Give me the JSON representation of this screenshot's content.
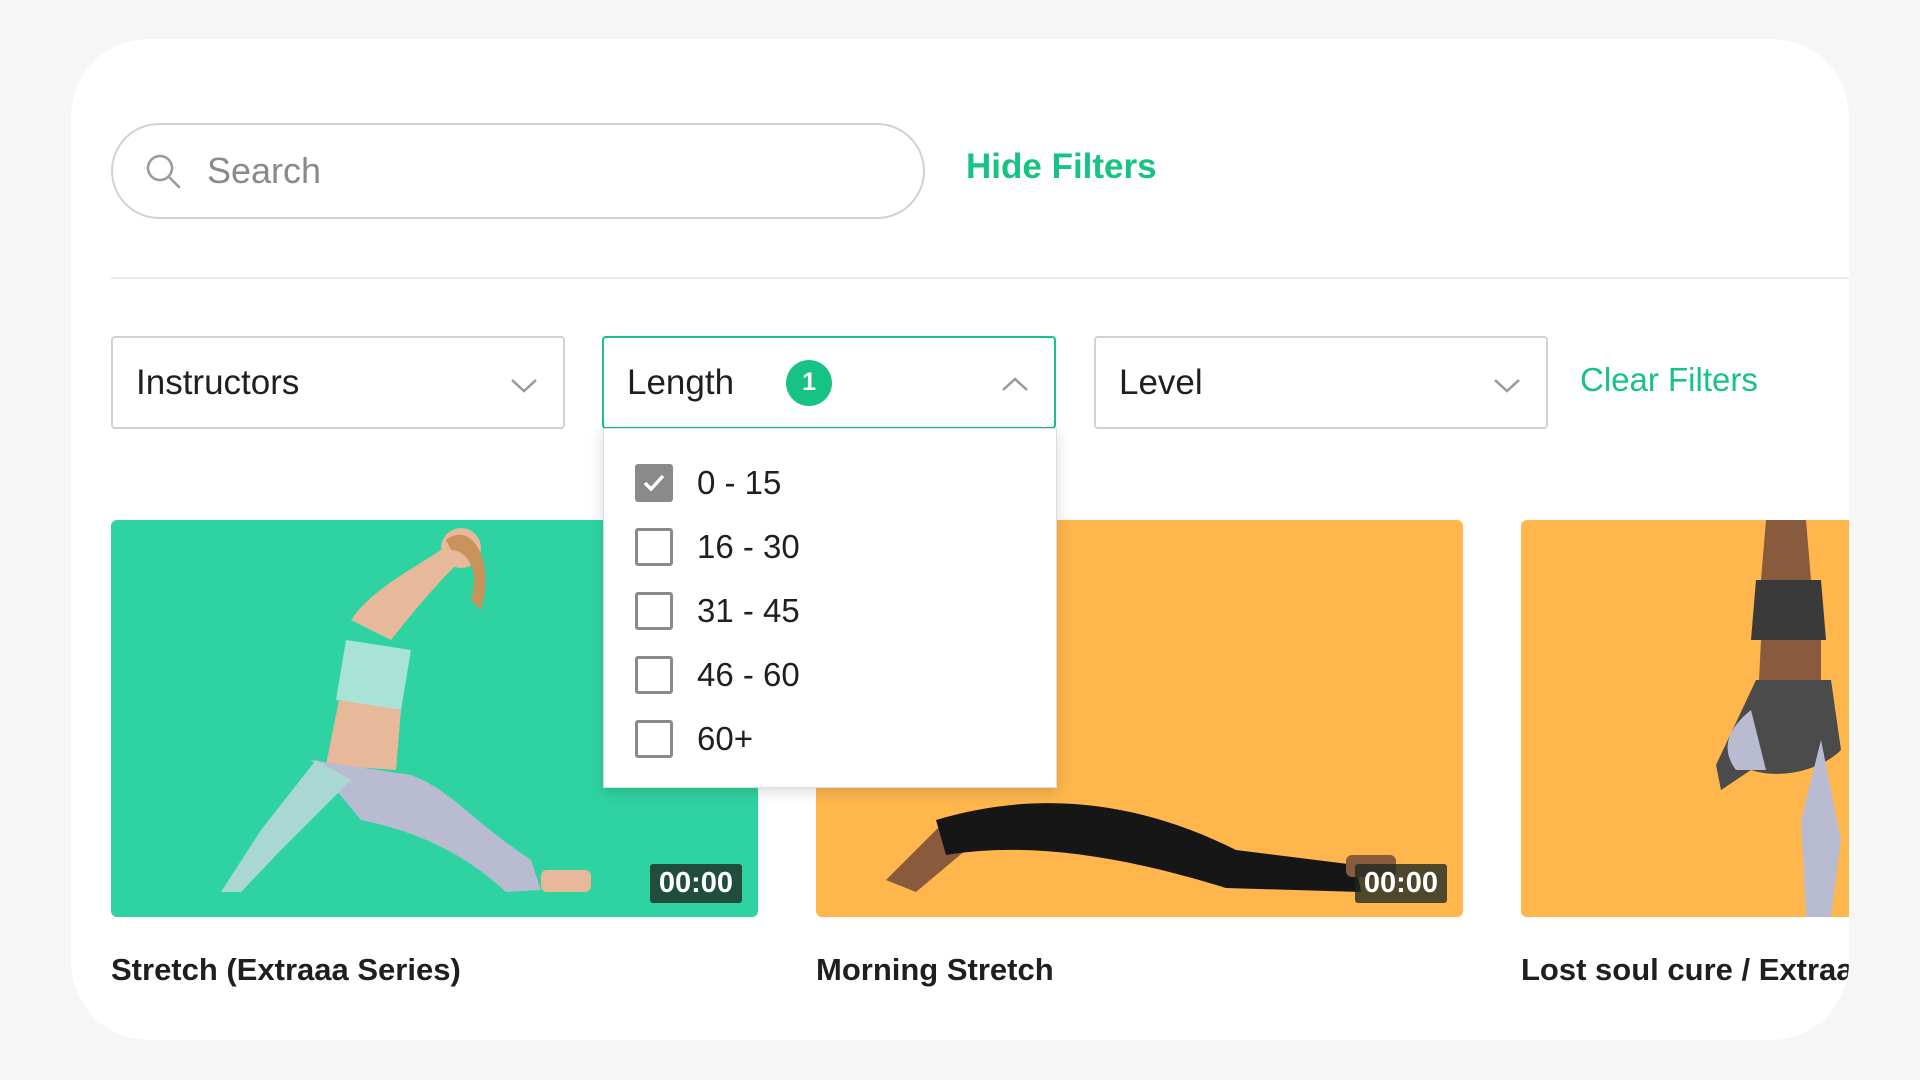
{
  "search": {
    "placeholder": "Search",
    "value": ""
  },
  "filters_toggle": "Hide Filters",
  "filters": {
    "instructors": {
      "label": "Instructors"
    },
    "length": {
      "label": "Length",
      "badge": "1",
      "options": [
        {
          "label": "0 - 15",
          "checked": true
        },
        {
          "label": "16 - 30",
          "checked": false
        },
        {
          "label": "31 - 45",
          "checked": false
        },
        {
          "label": "46 - 60",
          "checked": false
        },
        {
          "label": "60+",
          "checked": false
        }
      ]
    },
    "level": {
      "label": "Level"
    },
    "clear_label": "Clear Filters"
  },
  "videos": [
    {
      "title": "Stretch (Extraaa Series)",
      "duration": "00:00",
      "bg_color": "#2fd3a2"
    },
    {
      "title": "Morning Stretch",
      "duration": "00:00",
      "bg_color": "#ffb64d"
    },
    {
      "title": "Lost soul cure / Extraa Tutorial",
      "duration": "",
      "bg_color": "#ffb64d"
    }
  ],
  "colors": {
    "accent": "#17c285",
    "border": "#d2d2d2",
    "checkbox": "#8a8a8a"
  },
  "icons": [
    "search-icon",
    "chevron-down-icon",
    "chevron-up-icon",
    "check-icon"
  ]
}
